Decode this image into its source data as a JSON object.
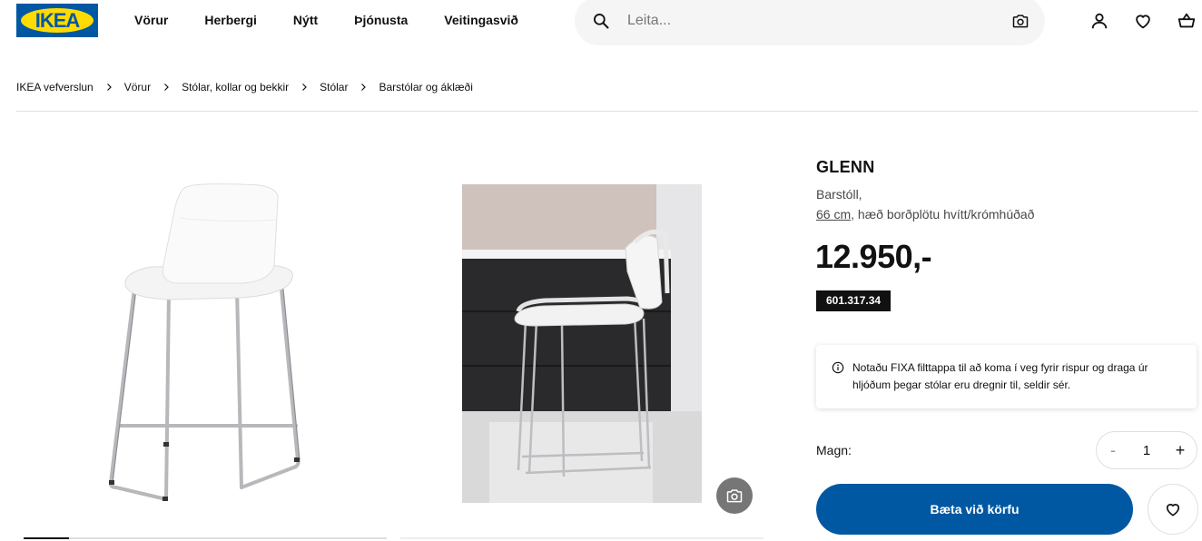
{
  "brand": {
    "logo_text": "IKEA",
    "accent": "#0058a3",
    "logo_yellow": "#ffdb00"
  },
  "nav": {
    "items": [
      {
        "label": "Vörur"
      },
      {
        "label": "Herbergi"
      },
      {
        "label": "Nýtt"
      },
      {
        "label": "Þjónusta"
      },
      {
        "label": "Veitingasvið"
      }
    ]
  },
  "search": {
    "placeholder": "Leita...",
    "value": "",
    "icon": "search-icon",
    "camera_icon": "camera-icon"
  },
  "header_icons": [
    "user-icon",
    "heart-icon",
    "cart-icon"
  ],
  "breadcrumb": {
    "items": [
      {
        "label": "IKEA vefverslun"
      },
      {
        "label": "Vörur"
      },
      {
        "label": "Stólar, kollar og bekkir"
      },
      {
        "label": "Stólar"
      },
      {
        "label": "Barstólar og áklæði"
      }
    ]
  },
  "product": {
    "name": "GLENN",
    "type": "Barstóll,",
    "dimension": "66 cm",
    "variant": ", hæð borðplötu hvítt/krómhúðað",
    "price": "12.950,-",
    "article_number": "601.317.34",
    "notice": "Notaðu FIXA filttappa til að koma í veg fyrir rispur og draga úr hljóðum þegar stólar eru dregnir til, seldir sér.",
    "quantity_label": "Magn:",
    "quantity": "1",
    "minus": "-",
    "plus": "+",
    "add_to_cart": "Bæta við körfu"
  }
}
